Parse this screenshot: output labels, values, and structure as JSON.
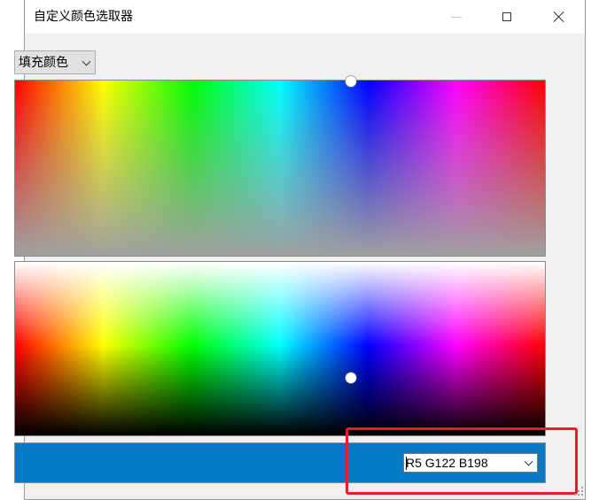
{
  "window": {
    "title": "自定义颜色选取器"
  },
  "mode_select": {
    "selected": "填充颜色"
  },
  "color_value": {
    "text": "R5 G122 B198",
    "hex": "#0579c6"
  },
  "icons": {
    "minimize": "minimize-icon",
    "maximize": "maximize-icon",
    "close": "close-icon",
    "dropdown": "chevron-down-icon"
  },
  "colors": {
    "highlight": "#e81e25",
    "selected_color": "#0579c6"
  }
}
